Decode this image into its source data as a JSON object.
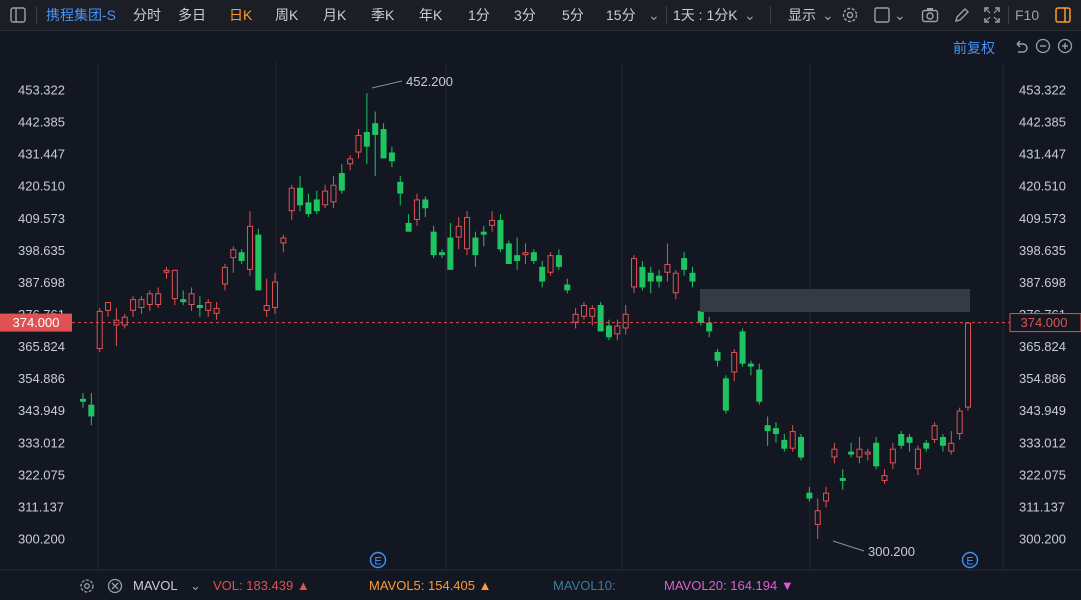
{
  "toolbar": {
    "symbol": "携程集团-S",
    "periods": [
      "分时",
      "多日",
      "日K",
      "周K",
      "月K",
      "季K",
      "年K",
      "1分",
      "3分",
      "5分",
      "15分"
    ],
    "active_period": "日K",
    "interval_label": "1天 : 1分K",
    "display_label": "显示",
    "f10_label": "F10"
  },
  "adjust_label": "前复权",
  "price_axis": {
    "labels": [
      "453.322",
      "442.385",
      "431.447",
      "420.510",
      "409.573",
      "398.635",
      "387.698",
      "376.761",
      "365.824",
      "354.886",
      "343.949",
      "333.012",
      "322.075",
      "311.137",
      "300.200"
    ],
    "current_price": "374.000"
  },
  "annotations": {
    "high": "452.200",
    "low": "300.200",
    "event_marker": "E"
  },
  "indicator_bar": {
    "name": "MAVOL",
    "vol": "VOL: 183.439 ▲",
    "mavol5": "MAVOL5: 154.405 ▲",
    "mavol10": "MAVOL10:",
    "mavol20": "MAVOL20: 164.194 ▼"
  },
  "colors": {
    "up": "#e05252",
    "down": "#1fc462",
    "accent": "#ff9a2e",
    "symbol": "#4a90f5",
    "price_line": "#e05252",
    "mavol5": "#ff9a2e",
    "mavol10": "#3b7a9c",
    "mavol20": "#e05cd0"
  },
  "chart_data": {
    "type": "candlestick",
    "ylim": [
      300.2,
      453.322
    ],
    "current_price": 374.0,
    "candles": [
      {
        "o": 348,
        "h": 350,
        "l": 345,
        "c": 347
      },
      {
        "o": 346,
        "h": 350,
        "l": 339,
        "c": 342
      },
      {
        "o": 365,
        "h": 379,
        "l": 364,
        "c": 378
      },
      {
        "o": 378,
        "h": 381,
        "l": 376,
        "c": 381
      },
      {
        "o": 373,
        "h": 379,
        "l": 366,
        "c": 375
      },
      {
        "o": 373,
        "h": 377,
        "l": 372,
        "c": 376
      },
      {
        "o": 378,
        "h": 383,
        "l": 376,
        "c": 382
      },
      {
        "o": 379,
        "h": 383,
        "l": 377,
        "c": 382
      },
      {
        "o": 380,
        "h": 385,
        "l": 378,
        "c": 384
      },
      {
        "o": 380,
        "h": 386,
        "l": 379,
        "c": 384
      },
      {
        "o": 391,
        "h": 393,
        "l": 389,
        "c": 392
      },
      {
        "o": 382,
        "h": 392,
        "l": 380,
        "c": 392
      },
      {
        "o": 382,
        "h": 385,
        "l": 380,
        "c": 381
      },
      {
        "o": 380,
        "h": 386,
        "l": 378,
        "c": 384
      },
      {
        "o": 380,
        "h": 383,
        "l": 376,
        "c": 379
      },
      {
        "o": 378,
        "h": 382,
        "l": 376,
        "c": 381
      },
      {
        "o": 377,
        "h": 381,
        "l": 375,
        "c": 379
      },
      {
        "o": 387,
        "h": 394,
        "l": 385,
        "c": 393
      },
      {
        "o": 396,
        "h": 400,
        "l": 391,
        "c": 399
      },
      {
        "o": 398,
        "h": 399,
        "l": 394,
        "c": 395
      },
      {
        "o": 392,
        "h": 412,
        "l": 390,
        "c": 407
      },
      {
        "o": 404,
        "h": 406,
        "l": 385,
        "c": 385
      },
      {
        "o": 378,
        "h": 389,
        "l": 376,
        "c": 380
      },
      {
        "o": 379,
        "h": 391,
        "l": 377,
        "c": 388
      },
      {
        "o": 401,
        "h": 404,
        "l": 398,
        "c": 403
      },
      {
        "o": 412,
        "h": 421,
        "l": 409,
        "c": 420
      },
      {
        "o": 420,
        "h": 424,
        "l": 412,
        "c": 414
      },
      {
        "o": 415,
        "h": 418,
        "l": 410,
        "c": 411
      },
      {
        "o": 416,
        "h": 419,
        "l": 411,
        "c": 412
      },
      {
        "o": 414,
        "h": 421,
        "l": 413,
        "c": 419
      },
      {
        "o": 415,
        "h": 424,
        "l": 413,
        "c": 421
      },
      {
        "o": 425,
        "h": 428,
        "l": 418,
        "c": 419
      },
      {
        "o": 428,
        "h": 431,
        "l": 426,
        "c": 430
      },
      {
        "o": 432,
        "h": 440,
        "l": 430,
        "c": 438
      },
      {
        "o": 439,
        "h": 452.2,
        "l": 428,
        "c": 434
      },
      {
        "o": 442,
        "h": 446,
        "l": 424,
        "c": 438
      },
      {
        "o": 440,
        "h": 442,
        "l": 430,
        "c": 430
      },
      {
        "o": 432,
        "h": 434,
        "l": 427,
        "c": 429
      },
      {
        "o": 422,
        "h": 424,
        "l": 414,
        "c": 418
      },
      {
        "o": 408,
        "h": 411,
        "l": 405,
        "c": 405
      },
      {
        "o": 409,
        "h": 418,
        "l": 407,
        "c": 416
      },
      {
        "o": 416,
        "h": 417,
        "l": 410,
        "c": 413
      },
      {
        "o": 405,
        "h": 407,
        "l": 396,
        "c": 397
      },
      {
        "o": 398,
        "h": 399,
        "l": 396,
        "c": 397
      },
      {
        "o": 403,
        "h": 408,
        "l": 392,
        "c": 392
      },
      {
        "o": 403,
        "h": 410,
        "l": 399,
        "c": 407
      },
      {
        "o": 399,
        "h": 412,
        "l": 397,
        "c": 410
      },
      {
        "o": 403,
        "h": 405,
        "l": 393,
        "c": 397
      },
      {
        "o": 405,
        "h": 407,
        "l": 400,
        "c": 404
      },
      {
        "o": 407,
        "h": 412,
        "l": 405,
        "c": 409
      },
      {
        "o": 409,
        "h": 411,
        "l": 398,
        "c": 399
      },
      {
        "o": 401,
        "h": 402,
        "l": 394,
        "c": 394
      },
      {
        "o": 397,
        "h": 403,
        "l": 392,
        "c": 395
      },
      {
        "o": 397,
        "h": 401,
        "l": 394,
        "c": 398
      },
      {
        "o": 398,
        "h": 399,
        "l": 394,
        "c": 395
      },
      {
        "o": 393,
        "h": 395,
        "l": 386,
        "c": 388
      },
      {
        "o": 391,
        "h": 398,
        "l": 390,
        "c": 397
      },
      {
        "o": 397,
        "h": 399,
        "l": 392,
        "c": 393
      },
      {
        "o": 387,
        "h": 389,
        "l": 384,
        "c": 385
      },
      {
        "o": 374,
        "h": 379,
        "l": 372,
        "c": 377
      },
      {
        "o": 376,
        "h": 381,
        "l": 375,
        "c": 380
      },
      {
        "o": 376,
        "h": 380,
        "l": 373,
        "c": 379
      },
      {
        "o": 380,
        "h": 381,
        "l": 371,
        "c": 371
      },
      {
        "o": 373,
        "h": 375,
        "l": 368,
        "c": 369
      },
      {
        "o": 370,
        "h": 375,
        "l": 368,
        "c": 373
      },
      {
        "o": 372,
        "h": 380,
        "l": 370,
        "c": 377
      },
      {
        "o": 386,
        "h": 397,
        "l": 384,
        "c": 396
      },
      {
        "o": 393,
        "h": 395,
        "l": 385,
        "c": 386
      },
      {
        "o": 391,
        "h": 393,
        "l": 384,
        "c": 388
      },
      {
        "o": 390,
        "h": 392,
        "l": 386,
        "c": 388
      },
      {
        "o": 391,
        "h": 401,
        "l": 388,
        "c": 394
      },
      {
        "o": 384,
        "h": 392,
        "l": 382,
        "c": 391
      },
      {
        "o": 396,
        "h": 398,
        "l": 390,
        "c": 392
      },
      {
        "o": 391,
        "h": 393,
        "l": 386,
        "c": 388
      },
      {
        "o": 378,
        "h": 379,
        "l": 373,
        "c": 374
      },
      {
        "o": 374,
        "h": 376,
        "l": 369,
        "c": 371
      },
      {
        "o": 364,
        "h": 365,
        "l": 359,
        "c": 361
      },
      {
        "o": 355,
        "h": 356,
        "l": 343,
        "c": 344
      },
      {
        "o": 357,
        "h": 365,
        "l": 354,
        "c": 364
      },
      {
        "o": 371,
        "h": 372,
        "l": 359,
        "c": 360
      },
      {
        "o": 360,
        "h": 361,
        "l": 356,
        "c": 359
      },
      {
        "o": 358,
        "h": 360,
        "l": 346,
        "c": 347
      },
      {
        "o": 339,
        "h": 342,
        "l": 332,
        "c": 337
      },
      {
        "o": 338,
        "h": 340,
        "l": 333,
        "c": 336
      },
      {
        "o": 334,
        "h": 336,
        "l": 330,
        "c": 331
      },
      {
        "o": 331,
        "h": 339,
        "l": 330,
        "c": 337
      },
      {
        "o": 335,
        "h": 336,
        "l": 327,
        "c": 328
      },
      {
        "o": 316,
        "h": 318,
        "l": 313,
        "c": 314
      },
      {
        "o": 305,
        "h": 314,
        "l": 300.2,
        "c": 310
      },
      {
        "o": 313,
        "h": 318,
        "l": 311,
        "c": 316
      },
      {
        "o": 328,
        "h": 333,
        "l": 326,
        "c": 331
      },
      {
        "o": 321,
        "h": 324,
        "l": 317,
        "c": 320
      },
      {
        "o": 330,
        "h": 333,
        "l": 328,
        "c": 329
      },
      {
        "o": 328,
        "h": 335,
        "l": 326,
        "c": 331
      },
      {
        "o": 329,
        "h": 331,
        "l": 327,
        "c": 330
      },
      {
        "o": 333,
        "h": 335,
        "l": 324,
        "c": 325
      },
      {
        "o": 320,
        "h": 324,
        "l": 319,
        "c": 322
      },
      {
        "o": 326,
        "h": 333,
        "l": 324,
        "c": 331
      },
      {
        "o": 336,
        "h": 337,
        "l": 331,
        "c": 332
      },
      {
        "o": 335,
        "h": 336,
        "l": 330,
        "c": 333
      },
      {
        "o": 324,
        "h": 332,
        "l": 322,
        "c": 331
      },
      {
        "o": 333,
        "h": 334,
        "l": 330,
        "c": 331
      },
      {
        "o": 334,
        "h": 340,
        "l": 333,
        "c": 339
      },
      {
        "o": 335,
        "h": 336,
        "l": 330,
        "c": 332
      },
      {
        "o": 330,
        "h": 337,
        "l": 329,
        "c": 333
      },
      {
        "o": 336,
        "h": 345,
        "l": 334,
        "c": 344
      },
      {
        "o": 345,
        "h": 374,
        "l": 344,
        "c": 374
      }
    ]
  }
}
